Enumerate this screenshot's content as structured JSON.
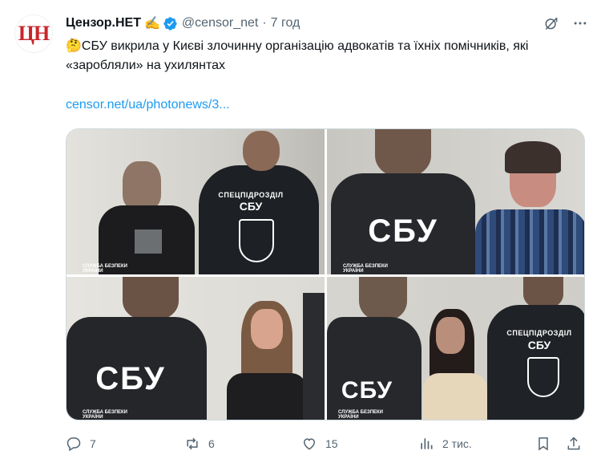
{
  "author": {
    "avatar_text": "ЦН",
    "name": "Цензор.НЕТ",
    "name_emoji": "✍️",
    "handle": "@censor_net",
    "separator": "·",
    "time": "7 год"
  },
  "tweet": {
    "emoji": "🤔",
    "text": "СБУ викрила у Києві злочинну організацію адвокатів та їхніх помічників, які «заробляли» на ухилянтах",
    "link": "censor.net/ua/photonews/3..."
  },
  "media": {
    "photos": [
      {
        "vest_title": "СПЕЦПІДРОЗДІЛ",
        "vest_sub": "СБУ",
        "watermark": "СЛУЖБА БЕЗПЕКИ УКРАЇНИ"
      },
      {
        "vest_big": "СБУ",
        "watermark": "СЛУЖБА БЕЗПЕКИ УКРАЇНИ"
      },
      {
        "vest_big": "СБУ",
        "watermark": "СЛУЖБА БЕЗПЕКИ УКРАЇНИ"
      },
      {
        "vest_title": "СПЕЦПІДРОЗДІЛ",
        "vest_sub": "СБУ",
        "vest_big": "СБУ",
        "watermark": "СЛУЖБА БЕЗПЕКИ УКРАЇНИ"
      }
    ]
  },
  "actions": {
    "replies": "7",
    "reposts": "6",
    "likes": "15",
    "views": "2 тис."
  },
  "colors": {
    "accent": "#1d9bf0",
    "muted": "#536471",
    "brand_red": "#c8262b"
  }
}
